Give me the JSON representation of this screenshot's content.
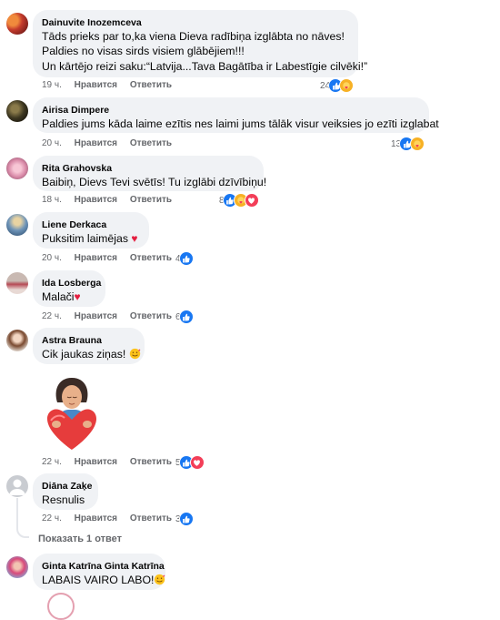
{
  "colors": {
    "like": "#1877f2",
    "care": "#f7b125",
    "love": "#f33e58",
    "meta": "#65676b",
    "bubble": "#f0f2f5"
  },
  "actions": {
    "like": "Нравится",
    "reply": "Ответить"
  },
  "comments": [
    {
      "author": "Dainuvite Inozemceva",
      "lines": [
        "Tāds prieks par to,ka viena Dieva radībiņa izglābta no nāves!",
        "Paldies no visas sirds visiem glābējiem!!!",
        "Un kārtējo reizi saku:“Latvija...Tava Bagātība ir Labestīgie cilvēki!”"
      ],
      "time": "19 ч.",
      "count": "24",
      "reactions": [
        "like-icon",
        "care-icon"
      ]
    },
    {
      "author": "Airisa Dimpere",
      "lines": [
        "Paldies jums kāda laime ezītis nes laimi jums tālāk visur veiksies jo ezīti izglabat"
      ],
      "time": "20 ч.",
      "count": "13",
      "reactions": [
        "like-icon",
        "care-icon"
      ]
    },
    {
      "author": "Rita Grahovska",
      "lines": [
        "Baibiņ, Dievs Tevi svētīs! Tu izglābi dzīvībiņu!"
      ],
      "time": "18 ч.",
      "count": "8",
      "reactions": [
        "like-icon",
        "care-icon",
        "love-icon"
      ]
    },
    {
      "author": "Liene Derkaca",
      "lines": [
        "Puksitim laimējas"
      ],
      "time": "20 ч.",
      "count": "4",
      "reactions": [
        "like-icon"
      ]
    },
    {
      "author": "Ida Losberga",
      "lines": [
        "Malači"
      ],
      "time": "22 ч.",
      "count": "6",
      "reactions": [
        "like-icon"
      ]
    },
    {
      "author": "Astra Brauna",
      "lines": [
        "Cik jaukas ziņas!"
      ],
      "time": "22 ч.",
      "count": "5",
      "reactions": [
        "like-icon",
        "love-icon"
      ]
    },
    {
      "author": "Diāna Zaķe",
      "lines": [
        "Resnulis"
      ],
      "time": "22 ч.",
      "count": "3",
      "reactions": [
        "like-icon"
      ]
    },
    {
      "author": "Ginta Katrīna Ginta Katrīna",
      "lines": [
        "LABAIS VAIRO LABO!"
      ]
    }
  ],
  "more_replies": "Показать 1 ответ"
}
